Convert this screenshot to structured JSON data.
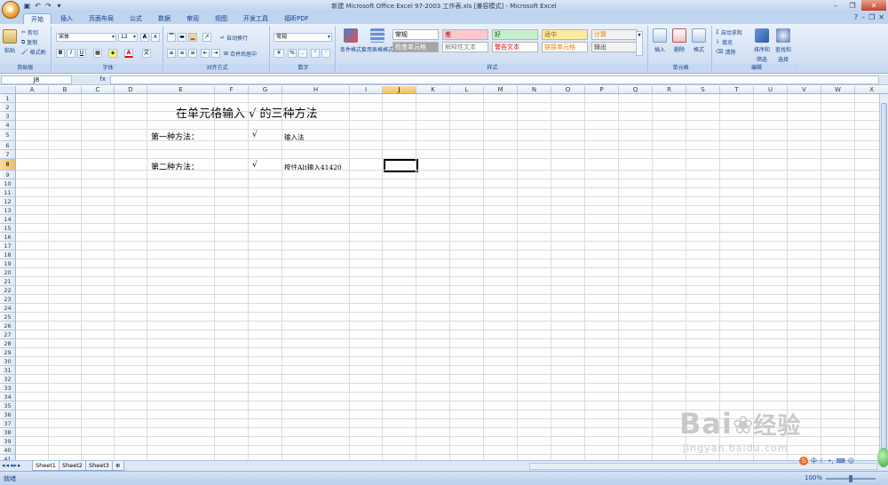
{
  "window": {
    "title": "新建 Microsoft Office Excel 97-2003 工作表.xls  [兼容模式] - Microsoft Excel"
  },
  "tabs": [
    "开始",
    "插入",
    "页面布局",
    "公式",
    "数据",
    "审阅",
    "视图",
    "开发工具",
    "福昕PDF"
  ],
  "ribbon": {
    "clipboard": {
      "label": "剪贴板",
      "paste": "粘贴",
      "cut": "剪切",
      "copy": "复制",
      "format_painter": "格式刷"
    },
    "font": {
      "label": "字体",
      "name": "宋体",
      "size": "12",
      "bold": "B",
      "italic": "I",
      "underline": "U",
      "grow": "A",
      "shrink": "A",
      "font_color": "A"
    },
    "alignment": {
      "label": "对齐方式",
      "wrap": "自动换行",
      "merge": "合并后居中"
    },
    "number": {
      "label": "数字",
      "format": "常规",
      "percent": "%",
      "comma": ","
    },
    "styles": {
      "label": "样式",
      "conditional": "条件格式",
      "table": "套用表格格式",
      "cells": [
        {
          "text": "常规",
          "bg": "#ffffff",
          "fg": "#000000"
        },
        {
          "text": "差",
          "bg": "#ffc7ce",
          "fg": "#9c0006"
        },
        {
          "text": "好",
          "bg": "#c6efce",
          "fg": "#006100"
        },
        {
          "text": "适中",
          "bg": "#ffeb9c",
          "fg": "#9c5700"
        },
        {
          "text": "计算",
          "bg": "#f2f2f2",
          "fg": "#fa7d00"
        },
        {
          "text": "检查单元格",
          "bg": "#a5a5a5",
          "fg": "#ffffff"
        },
        {
          "text": "解释性文本",
          "bg": "#ffffff",
          "fg": "#7f7f7f"
        },
        {
          "text": "警告文本",
          "bg": "#ffffff",
          "fg": "#ff0000"
        },
        {
          "text": "链接单元格",
          "bg": "#ffffff",
          "fg": "#fa7d00"
        },
        {
          "text": "输出",
          "bg": "#f2f2f2",
          "fg": "#3f3f3f"
        }
      ]
    },
    "cells": {
      "label": "单元格",
      "insert": "插入",
      "delete": "删除",
      "format": "格式"
    },
    "editing": {
      "label": "编辑",
      "autosum": "自动求和",
      "fill": "填充",
      "clear": "清除",
      "sort": "排序和",
      "sort2": "筛选",
      "find": "查找和",
      "find2": "选择"
    }
  },
  "formula_bar": {
    "name_box": "J8",
    "fx": "fx",
    "content": ""
  },
  "columns": [
    "A",
    "B",
    "C",
    "D",
    "E",
    "F",
    "G",
    "H",
    "I",
    "J",
    "K",
    "L",
    "M",
    "N",
    "O",
    "P",
    "Q",
    "R",
    "S",
    "T",
    "U",
    "V",
    "W",
    "X"
  ],
  "rows": [
    "1",
    "2",
    "3",
    "4",
    "5",
    "6",
    "7",
    "8",
    "9",
    "10",
    "11",
    "12",
    "13",
    "14",
    "15",
    "16",
    "17",
    "18",
    "19",
    "20",
    "21",
    "22",
    "23",
    "24",
    "25",
    "26",
    "27",
    "28",
    "29",
    "30",
    "31",
    "32",
    "33",
    "34",
    "35",
    "36",
    "37",
    "38",
    "39",
    "40",
    "41"
  ],
  "selected": {
    "column": "J",
    "row": "8"
  },
  "cells": {
    "title": "在单元格输入 √ 的三种方法",
    "e5": "第一种方法：",
    "g5": "√",
    "h5": "输入法",
    "e8": "第二种方法：",
    "g8": "√",
    "h8": "按住Alt输入41420"
  },
  "sheets": [
    "Sheet1",
    "Sheet2",
    "Sheet3"
  ],
  "status": {
    "text": "就绪",
    "zoom": "100%"
  },
  "ime": {
    "lang": "中"
  },
  "watermark": {
    "brand": "Bai",
    "brand2": "经验",
    "url": "jingyan.baidu.com"
  }
}
